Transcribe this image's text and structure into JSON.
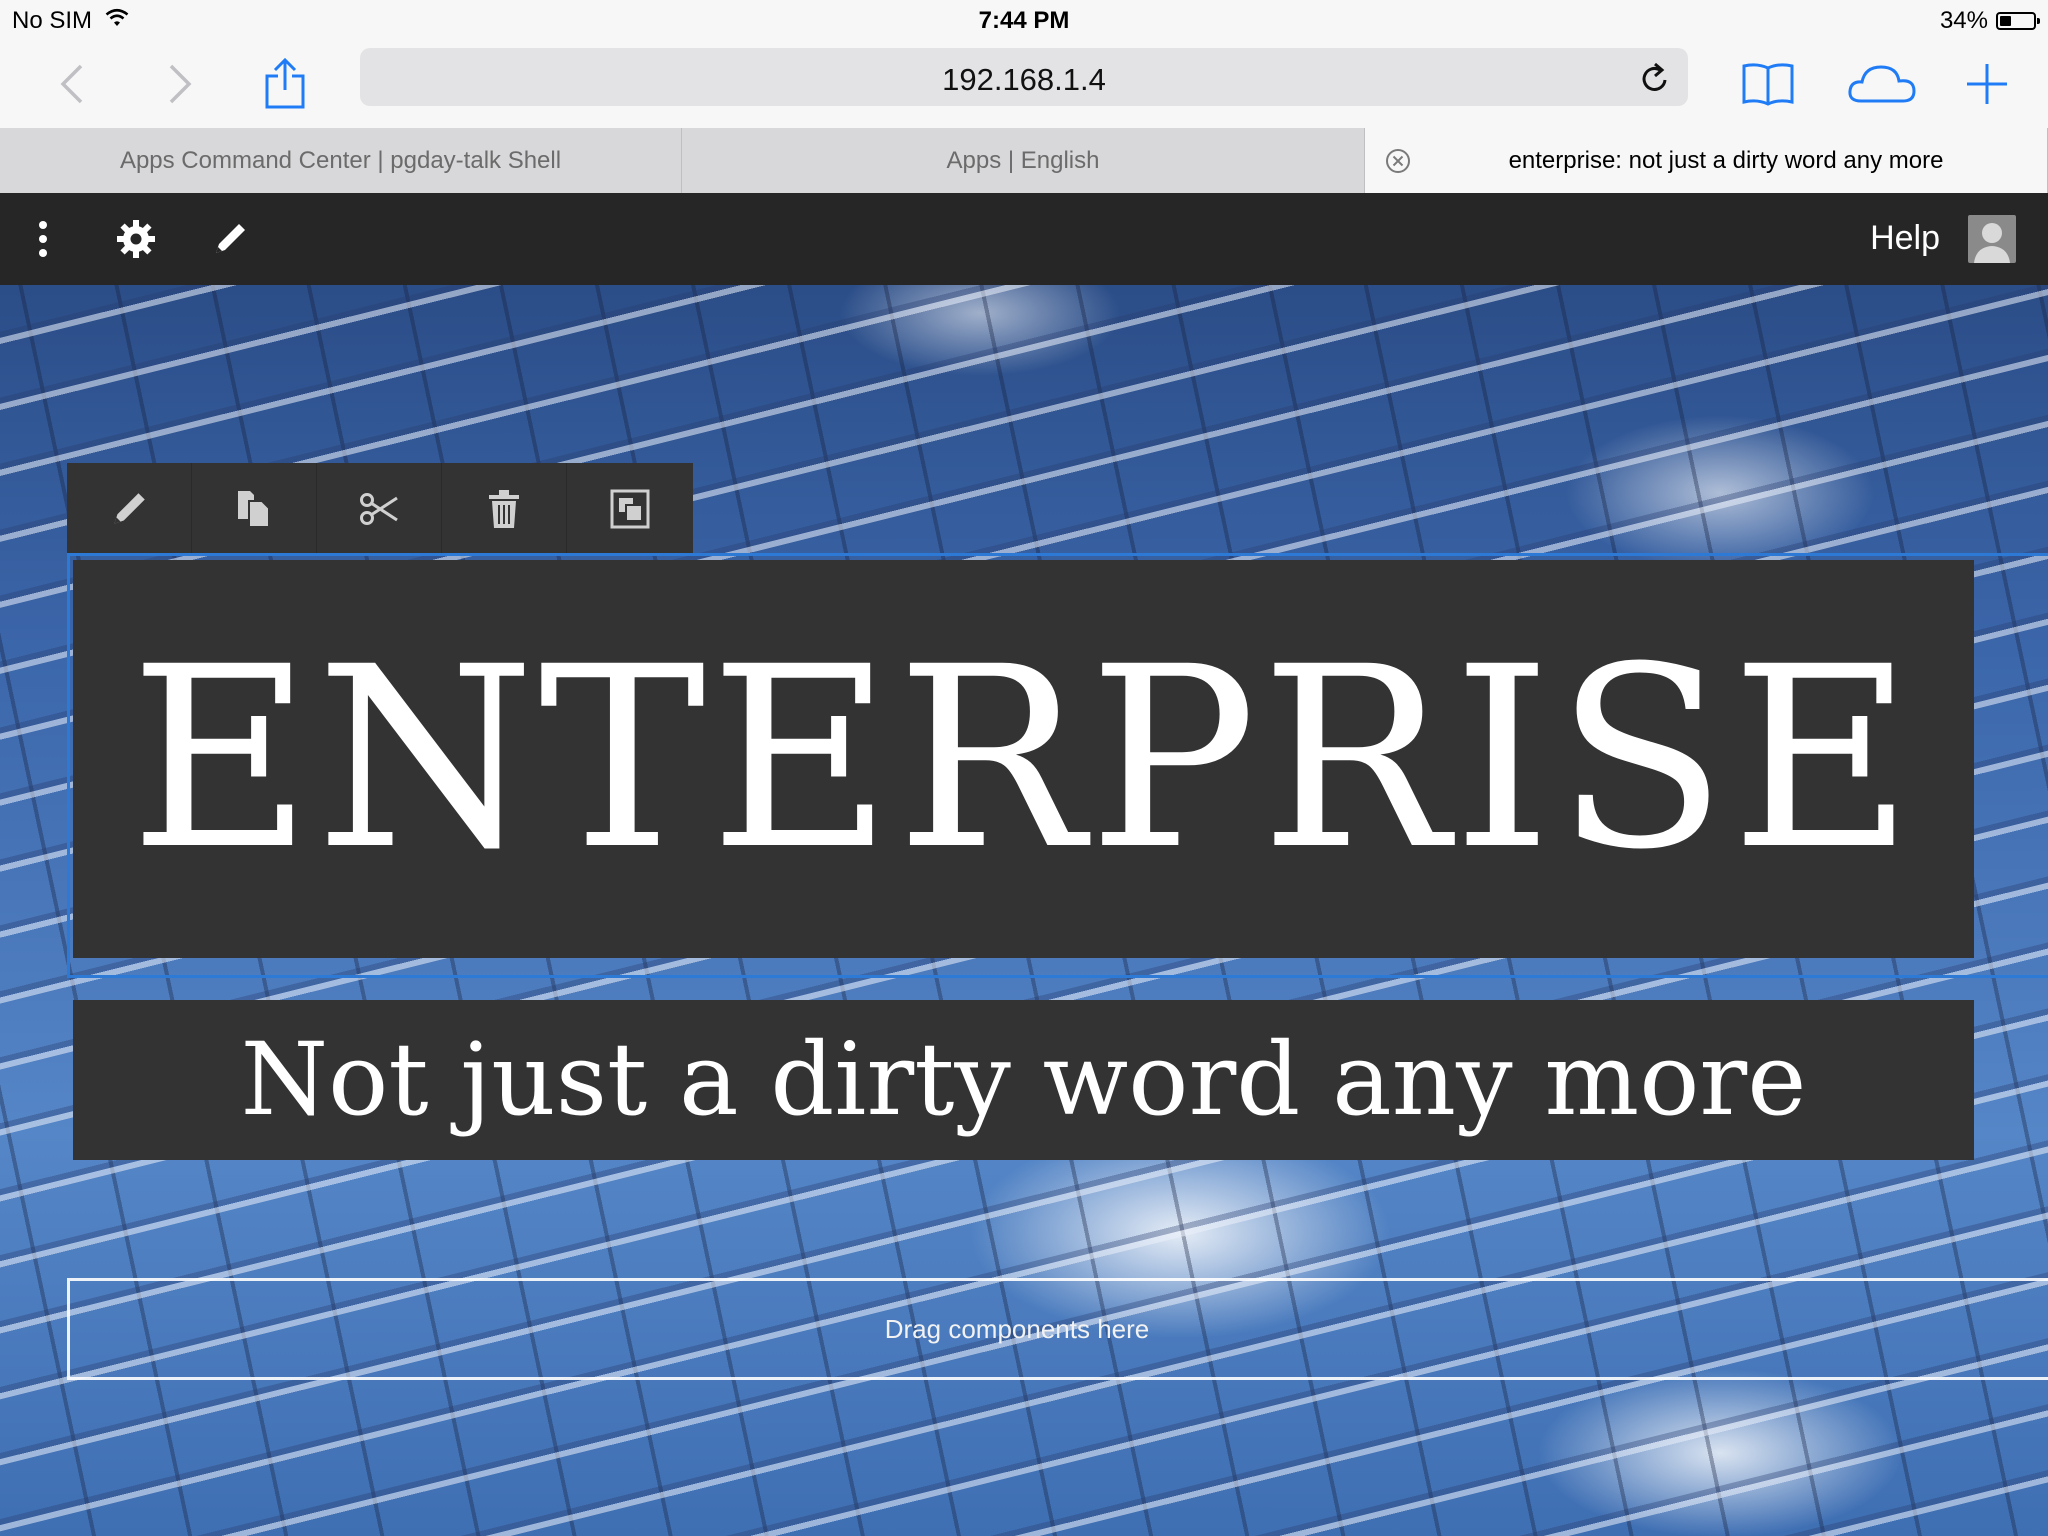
{
  "status_bar": {
    "carrier": "No SIM",
    "time": "7:44 PM",
    "battery_percent": "34%",
    "battery_level": 0.34
  },
  "browser": {
    "url": "192.168.1.4",
    "tabs": [
      {
        "title": "Apps Command Center | pgday-talk Shell",
        "active": false
      },
      {
        "title": "Apps | English",
        "active": false
      },
      {
        "title": "enterprise: not just a dirty word any more",
        "active": true
      }
    ]
  },
  "editor": {
    "help_label": "Help"
  },
  "content": {
    "title": "ENTERPRISE",
    "subtitle": "Not just a dirty word any more",
    "drop_zone_text": "Drag components here"
  },
  "colors": {
    "accent": "#2d7ad6",
    "editor_bar": "#262626",
    "title_bg": "#333333"
  },
  "icons": [
    "back-icon",
    "forward-icon",
    "share-icon",
    "reload-icon",
    "bookmarks-icon",
    "cloud-tabs-icon",
    "new-tab-icon",
    "tab-close-icon",
    "more-icon",
    "gear-icon",
    "pencil-icon",
    "copy-icon",
    "cut-icon",
    "trash-icon",
    "group-icon",
    "avatar-icon"
  ]
}
